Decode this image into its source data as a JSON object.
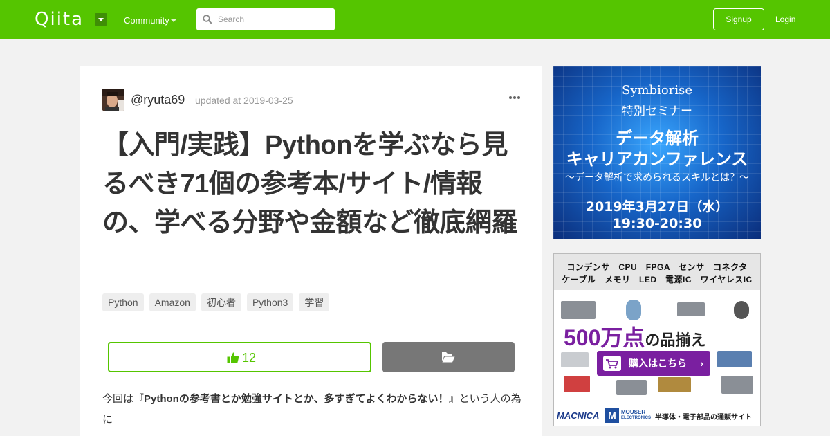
{
  "header": {
    "logo": "Qiita",
    "community_label": "Community",
    "search_placeholder": "Search",
    "signup_label": "Signup",
    "login_label": "Login",
    "brand_color": "#55c500"
  },
  "article": {
    "username": "@ryuta69",
    "updated": "updated at 2019-03-25",
    "title": "【入門/実践】Pythonを学ぶなら見るべき71個の参考本/サイト/情報の、学べる分野や金額など徹底網羅",
    "tags": [
      "Python",
      "Amazon",
      "初心者",
      "Python3",
      "学習"
    ],
    "like_count": "12",
    "body_prefix": "今回は『",
    "body_bold": "Pythonの参考書とか勉強サイトとか、多すぎてよくわからない！",
    "body_suffix": "』という人の為に"
  },
  "ads": {
    "ad1": {
      "brand": "Symbiorise",
      "seminar": "特別セミナー",
      "headline1": "データ解析",
      "headline2": "キャリアカンファレンス",
      "subtitle": "〜データ解析で求められるスキルとは？〜",
      "date": "2019年3月27日（水）",
      "time": "19:30-20:30"
    },
    "ad2": {
      "categories_line1": "コンデンサ　CPU　FPGA　センサ　コネクタ",
      "categories_line2": "ケーブル　メモリ　LED　電源IC　ワイヤレスIC",
      "headline_num": "500万点",
      "headline_rest": "の品揃え",
      "buy_label": "購入はこちら",
      "macnica": "MACNICA",
      "mouser_line1": "MOUSER",
      "mouser_line2": "ELECTRONICS",
      "shop_label": "半導体・電子部品の通販サイト"
    }
  }
}
